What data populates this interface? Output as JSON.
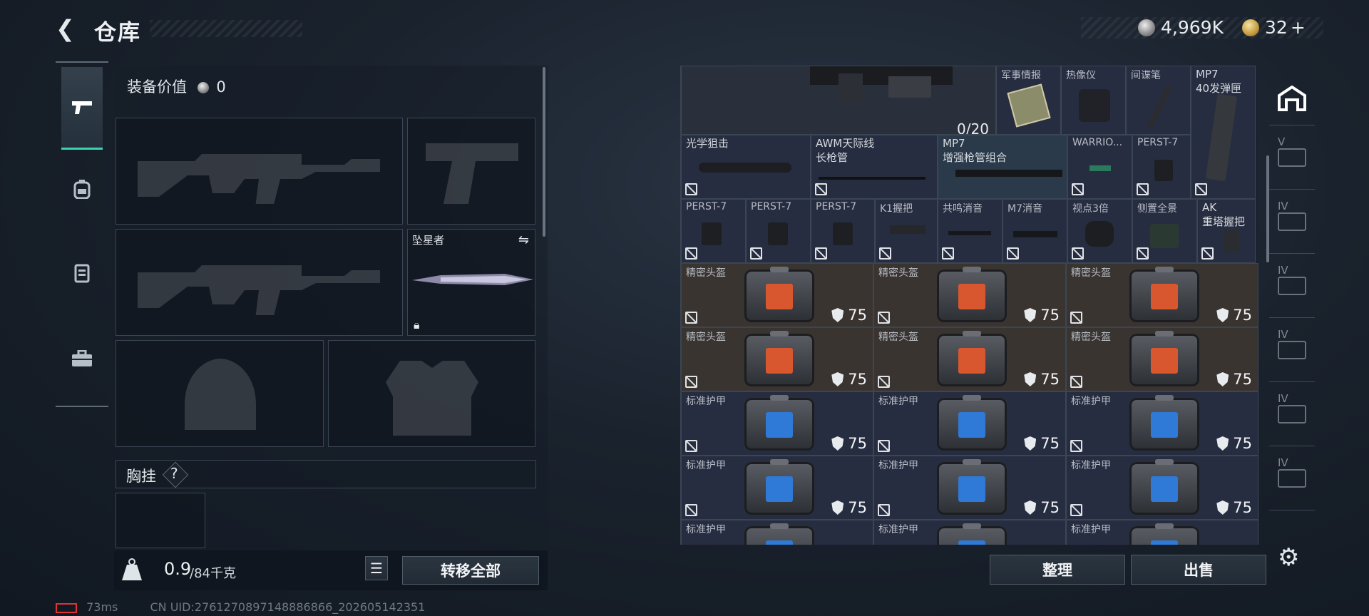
{
  "header": {
    "title": "仓库",
    "back_icon": "back-arrow-icon"
  },
  "currency": {
    "silver": "4,969K",
    "gold": "32",
    "gold_plus": "+"
  },
  "left": {
    "equip_value_label": "装备价值",
    "equip_value": "0",
    "slot_knife_label": "坠星者",
    "chest_label": "胸挂",
    "chest_help": "?",
    "weight_value": "0.9",
    "weight_unit": "/84千克",
    "transfer_all": "转移全部"
  },
  "grid": {
    "counter": "0/20",
    "row1": [
      {
        "name": "军事情报"
      },
      {
        "name": "热像仪"
      },
      {
        "name": "间谍笔"
      },
      {
        "name": "MP7",
        "name2": "40发弹匣"
      }
    ],
    "row2": [
      {
        "name": "光学狙击"
      },
      {
        "name": "AWM天际线",
        "name2": "长枪管"
      },
      {
        "name": "MP7",
        "name2": "增强枪管组合"
      },
      {
        "name": "WARRIO..."
      },
      {
        "name": "PERST-7"
      }
    ],
    "row3": [
      {
        "name": "PERST-7"
      },
      {
        "name": "PERST-7"
      },
      {
        "name": "PERST-7"
      },
      {
        "name": "K1握把"
      },
      {
        "name": "共鸣消音"
      },
      {
        "name": "M7消音"
      },
      {
        "name": "视点3倍"
      },
      {
        "name": "侧置全景"
      },
      {
        "name": "AK",
        "name2": "重塔握把"
      }
    ],
    "helmet_name": "精密头盔",
    "armor_name": "标准护甲",
    "durability": "75"
  },
  "buttons": {
    "sort": "整理",
    "sell": "出售"
  },
  "rail": [
    "V",
    "IV",
    "IV",
    "IV",
    "IV",
    "IV"
  ],
  "status": {
    "ping": "73ms",
    "uid": "CN UID:2761270897148886866_202605142351"
  },
  "colors": {
    "accent": "#3dd2b2",
    "cell": "#272d40",
    "cell_brown": "#3a3430",
    "helmet_screen": "#d9572f",
    "armor_screen": "#2e7ad6"
  }
}
